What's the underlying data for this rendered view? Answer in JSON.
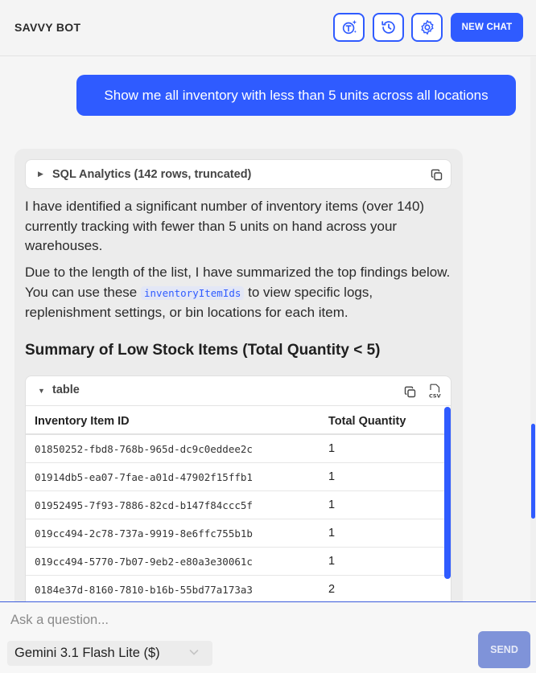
{
  "header": {
    "title": "SAVVY BOT",
    "new_chat_label": "NEW CHAT",
    "icons": [
      "translate-sparkle-icon",
      "history-icon",
      "gear-icon"
    ]
  },
  "conversation": {
    "user_message": "Show me all inventory with less than 5 units across all locations",
    "assistant": {
      "sql_summary": "SQL Analytics (142 rows, truncated)",
      "paragraph1": "I have identified a significant number of inventory items (over 140) currently tracking with fewer than 5 units on hand across your warehouses.",
      "paragraph2_before": "Due to the length of the list, I have summarized the top findings below. You can use these ",
      "paragraph2_code": "inventoryItemIds",
      "paragraph2_after": " to view specific logs, replenishment settings, or bin locations for each item.",
      "section_title": "Summary of Low Stock Items (Total Quantity < 5)",
      "table": {
        "label": "table",
        "columns": [
          "Inventory Item ID",
          "Total Quantity"
        ],
        "rows": [
          [
            "01850252-fbd8-768b-965d-dc9c0eddee2c",
            "1"
          ],
          [
            "01914db5-ea07-7fae-a01d-47902f15ffb1",
            "1"
          ],
          [
            "01952495-7f93-7886-82cd-b147f84ccc5f",
            "1"
          ],
          [
            "019cc494-2c78-737a-9919-8e6ffc755b1b",
            "1"
          ],
          [
            "019cc494-5770-7b07-9eb2-e80a3e30061c",
            "1"
          ],
          [
            "0184e37d-8160-7810-b16b-55bd77a173a3",
            "2"
          ]
        ]
      }
    }
  },
  "composer": {
    "placeholder": "Ask a question...",
    "model_selected": "Gemini 3.1 Flash Lite ($)",
    "send_label": "SEND"
  },
  "colors": {
    "accent": "#2f5bff",
    "send_disabled": "#7f93d9"
  }
}
